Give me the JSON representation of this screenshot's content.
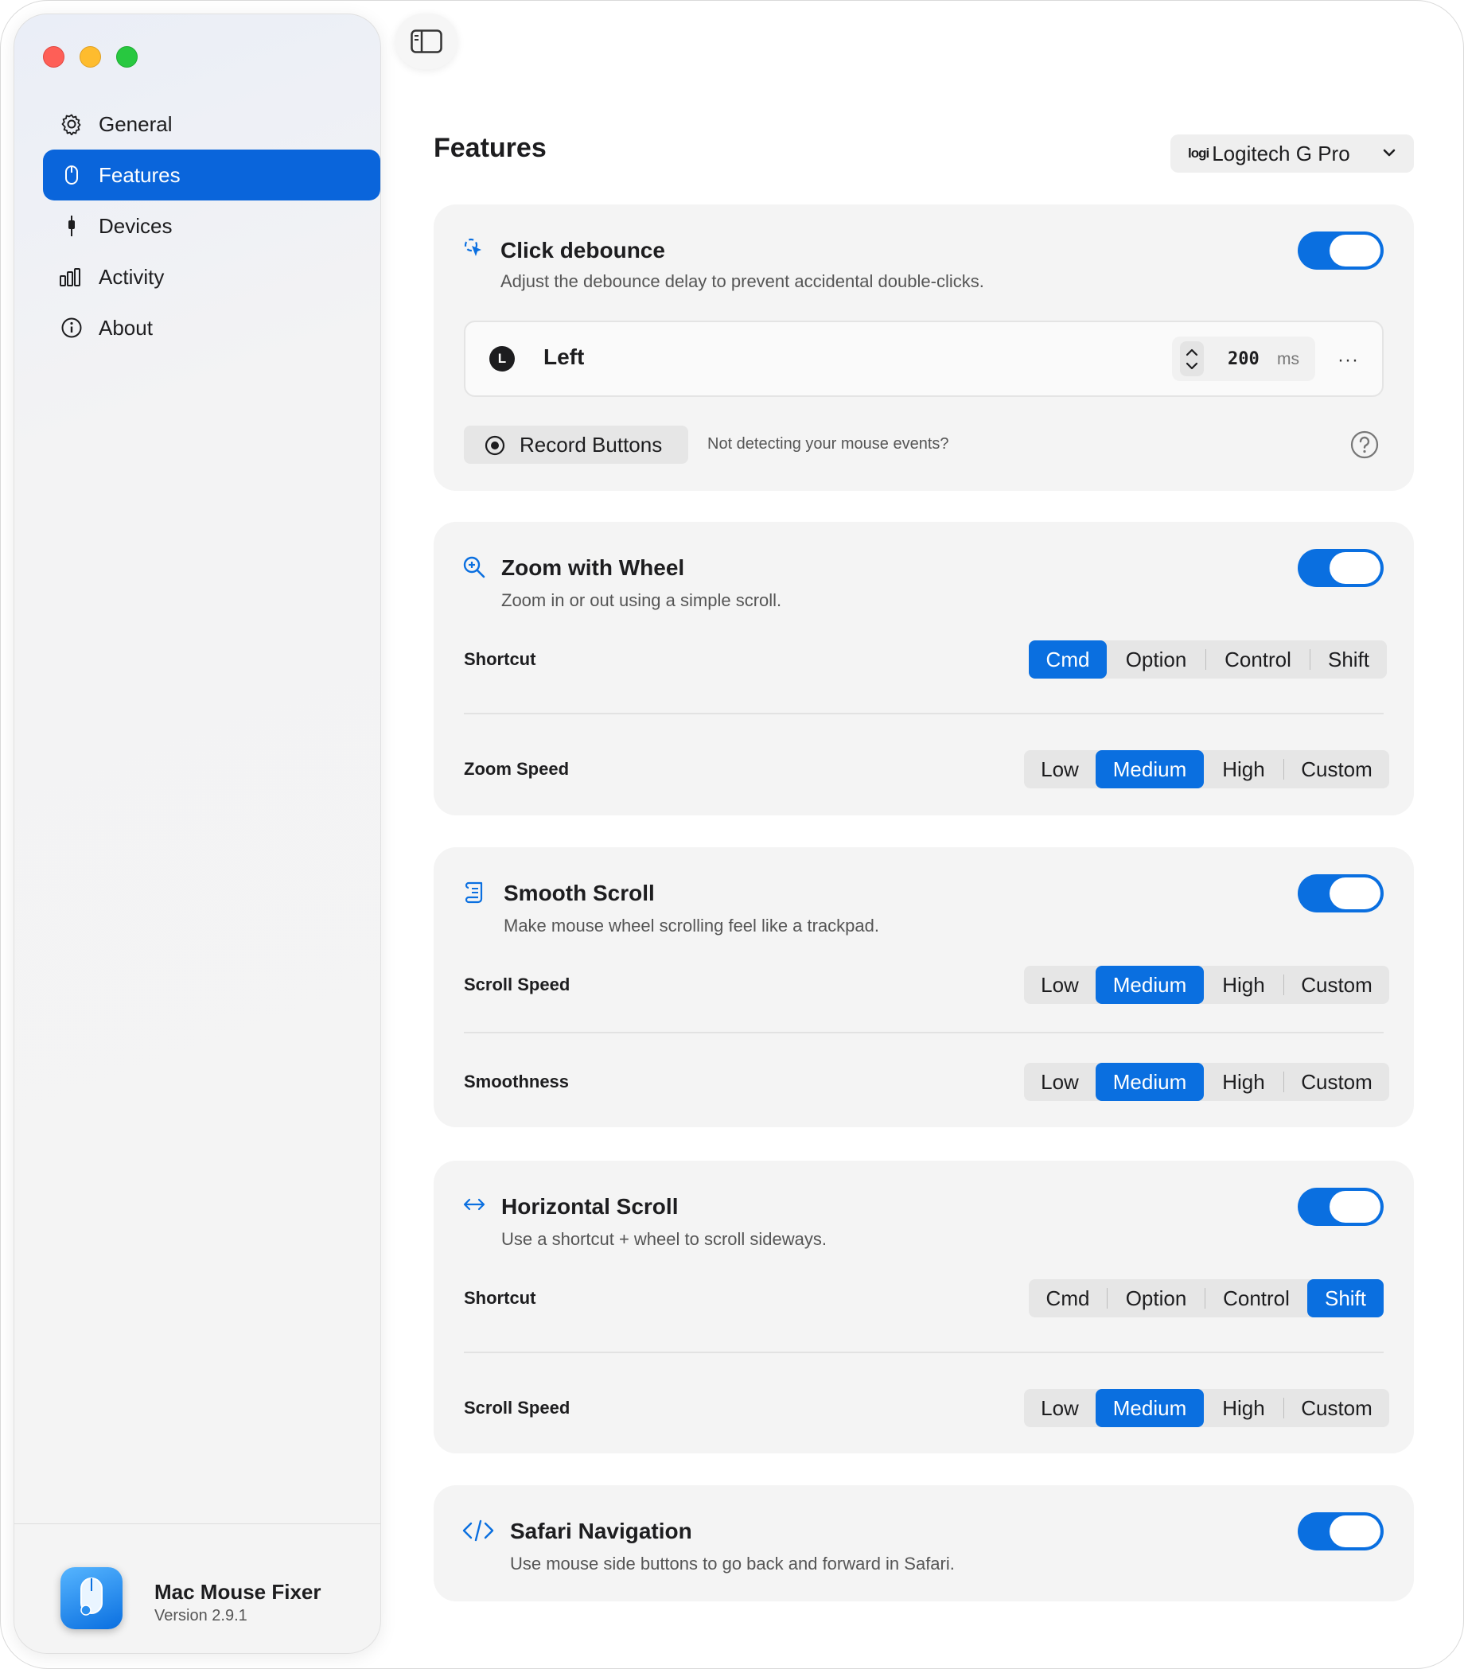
{
  "sidebar": {
    "items": [
      {
        "label": "General",
        "icon": "gear-icon",
        "active": false
      },
      {
        "label": "Features",
        "icon": "mouse-icon",
        "active": true
      },
      {
        "label": "Devices",
        "icon": "device-icon",
        "active": false
      },
      {
        "label": "Activity",
        "icon": "chart-icon",
        "active": false
      },
      {
        "label": "About",
        "icon": "info-icon",
        "active": false
      }
    ],
    "app_name": "Mac Mouse Fixer",
    "version": "Version 2.9.1"
  },
  "header": {
    "title": "Features",
    "device_logo": "logi",
    "device": "Logitech G Pro"
  },
  "colors": {
    "accent": "#0a6fe0",
    "sidebar_active": "#0a65db",
    "close": "#fe5f57",
    "minimize": "#febc2e",
    "zoom": "#28c840",
    "card": "#f4f4f4"
  },
  "click_debounce": {
    "title": "Click debounce",
    "description": "Adjust the debounce delay to prevent accidental double-clicks.",
    "enabled": true,
    "button": {
      "badge": "L",
      "label": "Left",
      "value": "200",
      "unit": "ms",
      "more": "···"
    },
    "record_label": "Record Buttons",
    "hint": "Not detecting your mouse events?"
  },
  "zoom": {
    "title": "Zoom with Wheel",
    "description": "Zoom in or out using a simple scroll.",
    "enabled": true,
    "shortcut_label": "Shortcut",
    "shortcut": {
      "options": [
        "Cmd",
        "Option",
        "Control",
        "Shift"
      ],
      "selected": "Cmd"
    },
    "speed_label": "Zoom Speed",
    "speed": {
      "options": [
        "Low",
        "Medium",
        "High",
        "Custom"
      ],
      "selected": "Medium"
    }
  },
  "smooth_scroll": {
    "title": "Smooth Scroll",
    "description": "Make mouse wheel scrolling feel like a trackpad.",
    "enabled": true,
    "speed_label": "Scroll Speed",
    "speed": {
      "options": [
        "Low",
        "Medium",
        "High",
        "Custom"
      ],
      "selected": "Medium"
    },
    "smooth_label": "Smoothness",
    "smoothness": {
      "options": [
        "Low",
        "Medium",
        "High",
        "Custom"
      ],
      "selected": "Medium"
    }
  },
  "horizontal_scroll": {
    "title": "Horizontal Scroll",
    "description": "Use a shortcut + wheel to scroll sideways.",
    "enabled": true,
    "shortcut_label": "Shortcut",
    "shortcut": {
      "options": [
        "Cmd",
        "Option",
        "Control",
        "Shift"
      ],
      "selected": "Shift"
    },
    "speed_label": "Scroll Speed",
    "speed": {
      "options": [
        "Low",
        "Medium",
        "High",
        "Custom"
      ],
      "selected": "Medium"
    }
  },
  "safari": {
    "title": "Safari Navigation",
    "description": "Use mouse side buttons to go back and forward in Safari.",
    "enabled": true
  }
}
